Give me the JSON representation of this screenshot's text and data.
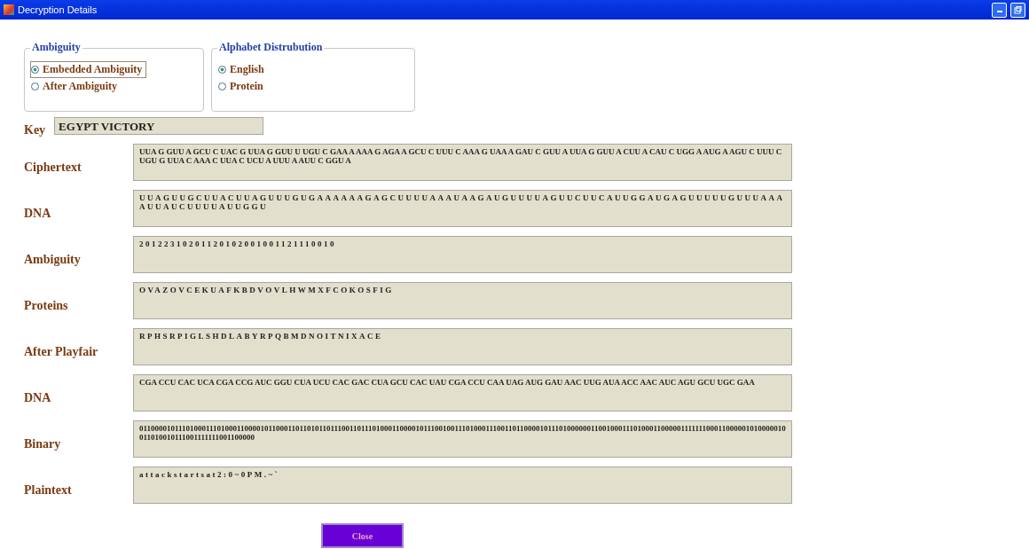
{
  "window": {
    "title": "Decryption Details"
  },
  "groups": [
    {
      "title": "Ambiguity",
      "options": [
        {
          "label": "Embedded Ambiguity",
          "selected": true,
          "focused": true
        },
        {
          "label": "After Ambiguity",
          "selected": false,
          "focused": false
        }
      ]
    },
    {
      "title": "Alphabet Distrubution",
      "options": [
        {
          "label": "English",
          "selected": true,
          "focused": false
        },
        {
          "label": "Protein",
          "selected": false,
          "focused": false
        }
      ]
    }
  ],
  "key": {
    "label": "Key",
    "value": "EGYPT VICTORY"
  },
  "fields": [
    {
      "label": "Ciphertext",
      "value": "UUA G GUU A GCU C UAC G UUA G GUU U UGU C GAA A AAA G AGA A GCU C UUU C AAA G UAA A GAU C GUU A UUA G GUU A CUU A CAU C UGG A AUG A AGU C UUU C UGU G UUA C AAA C UUA C UCU A UUU A AUU C GGU A",
      "spaced": false
    },
    {
      "label": "DNA",
      "value": "UUAGUUGCUUACUUAGUUUGUGAAAAAAGAGCUUUUAAAUAAGAUGUUUUAGUUCUUCAUUGGAUGAGUUUUUGUUUAAAAUUAUCUUUUAUUGGU",
      "spaced": true
    },
    {
      "label": "Ambiguity",
      "value": "20122310201120102001001121110010",
      "spaced": true
    },
    {
      "label": "Proteins",
      "value": "OVAZOVCEKUAFKBDVOVLHWMXFCOKOSFIG",
      "spaced": true
    },
    {
      "label": "After Playfair",
      "value": "RPHSRPIGLSHDLABYRPQBMDNOITNIXACE",
      "spaced": true
    },
    {
      "label": "DNA",
      "value": "CGA CCU CAC UCA CGA CCG AUC GGU CUA UCU CAC GAC CUA GCU CAC UAU CGA CCU CAA UAG AUG GAU AAC UUG AUA ACC AAC AUC AGU GCU UGC GAA",
      "spaced": false
    },
    {
      "label": "Binary",
      "value": "0110000101110100011101000110000101100011011010110111001101110100011000010111001001110100011100110110000101110100000011001000111010001100000111111100011000001010000010011010010111001111111001100000",
      "spaced": false
    },
    {
      "label": "Plaintext",
      "value": "attackstartsat2:0~0PM.~`",
      "spaced": true
    }
  ],
  "close_button": {
    "label": "Close"
  }
}
